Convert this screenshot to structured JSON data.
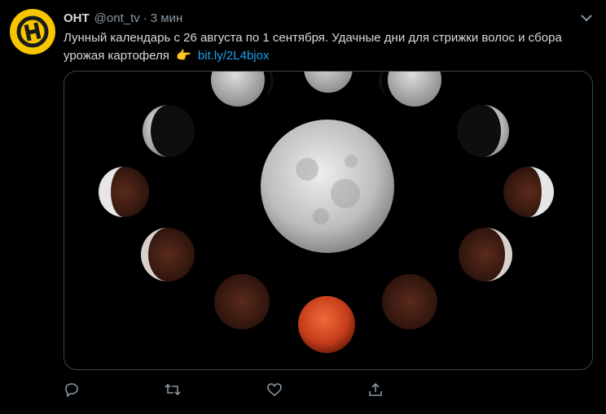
{
  "tweet": {
    "author_name": "ОНТ",
    "handle": "@ont_tv",
    "separator": "·",
    "time": "3 мин",
    "text": "Лунный календарь с 26 августа по 1 сентября. Удачные дни для стрижки волос и сбора урожая картофеля",
    "emoji": "👉",
    "link": "bit.ly/2L4bjox"
  },
  "colors": {
    "accent": "#1da1f2",
    "avatar_bg": "#f7c600",
    "muted": "#8899a6",
    "background": "#000000"
  },
  "icons": {
    "avatar": "ont-logo-icon",
    "menu": "chevron-down-icon",
    "reply": "reply-icon",
    "retweet": "retweet-icon",
    "like": "heart-icon",
    "share": "share-icon"
  }
}
